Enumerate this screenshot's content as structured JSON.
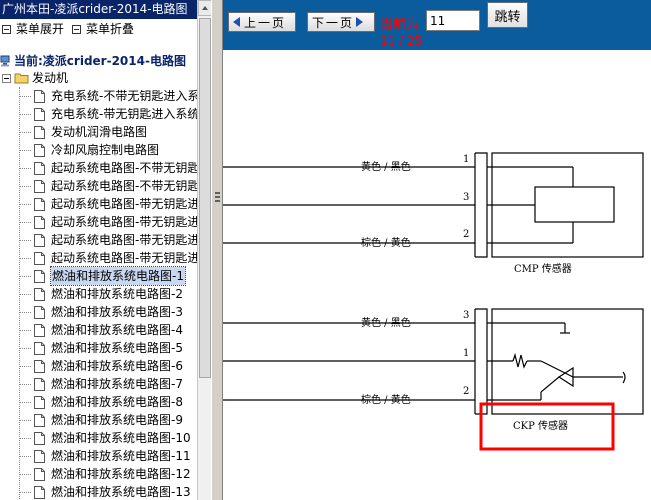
{
  "window": {
    "title": "广州本田-凌派crider-2014-电路图"
  },
  "menu": {
    "expand_label": "菜单展开",
    "collapse_label": "菜单折叠"
  },
  "current": {
    "label": "当前:凌派crider-2014-电路图"
  },
  "tree": {
    "folder": "发动机",
    "items": [
      {
        "label": "充电系统-不带无钥匙进入系"
      },
      {
        "label": "充电系统-带无钥匙进入系统"
      },
      {
        "label": "发动机润滑电路图"
      },
      {
        "label": "冷却风扇控制电路图"
      },
      {
        "label": "起动系统电路图-不带无钥匙"
      },
      {
        "label": "起动系统电路图-不带无钥匙"
      },
      {
        "label": "起动系统电路图-带无钥匙进"
      },
      {
        "label": "起动系统电路图-带无钥匙进"
      },
      {
        "label": "起动系统电路图-带无钥匙进"
      },
      {
        "label": "起动系统电路图-带无钥匙进"
      },
      {
        "label": "燃油和排放系统电路图-1"
      },
      {
        "label": "燃油和排放系统电路图-2"
      },
      {
        "label": "燃油和排放系统电路图-3"
      },
      {
        "label": "燃油和排放系统电路图-4"
      },
      {
        "label": "燃油和排放系统电路图-5"
      },
      {
        "label": "燃油和排放系统电路图-6"
      },
      {
        "label": "燃油和排放系统电路图-7"
      },
      {
        "label": "燃油和排放系统电路图-8"
      },
      {
        "label": "燃油和排放系统电路图-9"
      },
      {
        "label": "燃油和排放系统电路图-10"
      },
      {
        "label": "燃油和排放系统电路图-11"
      },
      {
        "label": "燃油和排放系统电路图-12"
      },
      {
        "label": "燃油和排放系统电路图-13"
      }
    ],
    "selected_index": 10
  },
  "toolbar": {
    "prev_label": "上一页",
    "next_label": "下一页",
    "current_label": "当前为",
    "page_value": "11",
    "page_indicator": "11 / 25",
    "go_label": "跳转"
  },
  "diagram": {
    "cmp": {
      "name": "CMP 传感器",
      "wires": [
        {
          "pin": "1",
          "color": "黄色 / 黑色"
        },
        {
          "pin": "3",
          "color": ""
        },
        {
          "pin": "2",
          "color": "棕色 / 黄色"
        }
      ]
    },
    "ckp": {
      "name": "CKP 传感器",
      "wires": [
        {
          "pin": "3",
          "color": "黄色 / 黑色"
        },
        {
          "pin": "1",
          "color": ""
        },
        {
          "pin": "2",
          "color": "棕色 / 黄色"
        }
      ]
    },
    "highlight_color": "#ff0000"
  },
  "colors": {
    "titlebar": "#0a246a",
    "toolbar": "#0a5c9c",
    "accent_red": "#ff0000"
  }
}
